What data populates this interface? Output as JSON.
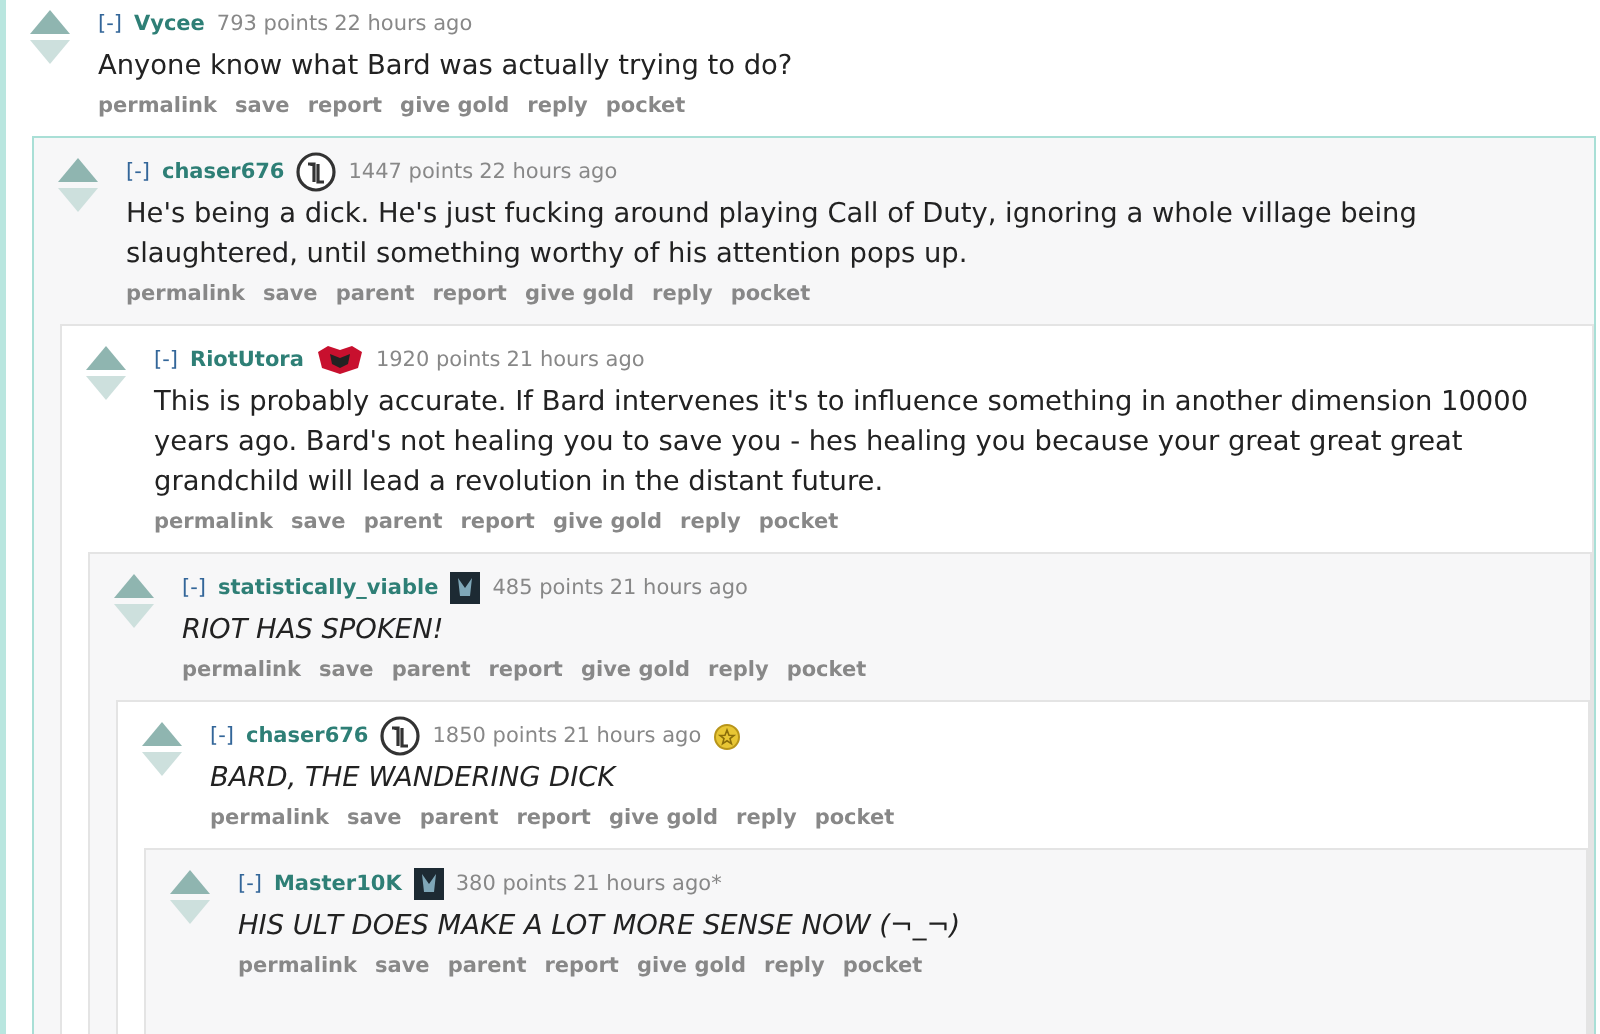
{
  "comments": [
    {
      "collapse": "[-]",
      "author": "Vycee",
      "score": "793 points",
      "time": "22 hours ago",
      "emphasis": false,
      "body": "Anyone know what Bard was actually trying to do?",
      "actions": [
        "permalink",
        "save",
        "report",
        "give gold",
        "reply",
        "pocket"
      ],
      "children": [
        {
          "collapse": "[-]",
          "author": "chaser676",
          "kind": "ring",
          "score": "1447 points",
          "time": "22 hours ago",
          "emphasis": false,
          "body": "He's being a dick. He's just fucking around playing Call of Duty, ignoring a whole village being slaughtered, until something worthy of his attention pops up.",
          "actions": [
            "permalink",
            "save",
            "parent",
            "report",
            "give gold",
            "reply",
            "pocket"
          ],
          "children": [
            {
              "collapse": "[-]",
              "author": "RiotUtora",
              "kind": "emblem",
              "score": "1920 points",
              "time": "21 hours ago",
              "emphasis": false,
              "body": "This is probably accurate. If Bard intervenes it's to influence something in another dimension 10000 years ago. Bard's not healing you to save you - hes healing you because your great great great grandchild will lead a revolution in the distant future.",
              "actions": [
                "permalink",
                "save",
                "parent",
                "report",
                "give gold",
                "reply",
                "pocket"
              ],
              "children": [
                {
                  "collapse": "[-]",
                  "author": "statistically_viable",
                  "kind": "square",
                  "score": "485 points",
                  "time": "21 hours ago",
                  "emphasis": true,
                  "body": "RIOT HAS SPOKEN!",
                  "actions": [
                    "permalink",
                    "save",
                    "parent",
                    "report",
                    "give gold",
                    "reply",
                    "pocket"
                  ],
                  "children": [
                    {
                      "collapse": "[-]",
                      "author": "chaser676",
                      "kind": "ring",
                      "score": "1850 points",
                      "time": "21 hours ago",
                      "gilded": true,
                      "emphasis": true,
                      "body": "BARD, THE WANDERING DICK",
                      "actions": [
                        "permalink",
                        "save",
                        "parent",
                        "report",
                        "give gold",
                        "reply",
                        "pocket"
                      ],
                      "children": [
                        {
                          "collapse": "[-]",
                          "author": "Master10K",
                          "kind": "square",
                          "score": "380 points",
                          "time": "21 hours ago*",
                          "emphasis": true,
                          "body": "HIS ULT DOES MAKE A LOT MORE SENSE NOW (¬_¬)",
                          "actions": [
                            "permalink",
                            "save",
                            "parent",
                            "report",
                            "give gold",
                            "reply",
                            "pocket"
                          ]
                        }
                      ]
                    }
                  ]
                }
              ]
            }
          ]
        }
      ]
    }
  ]
}
